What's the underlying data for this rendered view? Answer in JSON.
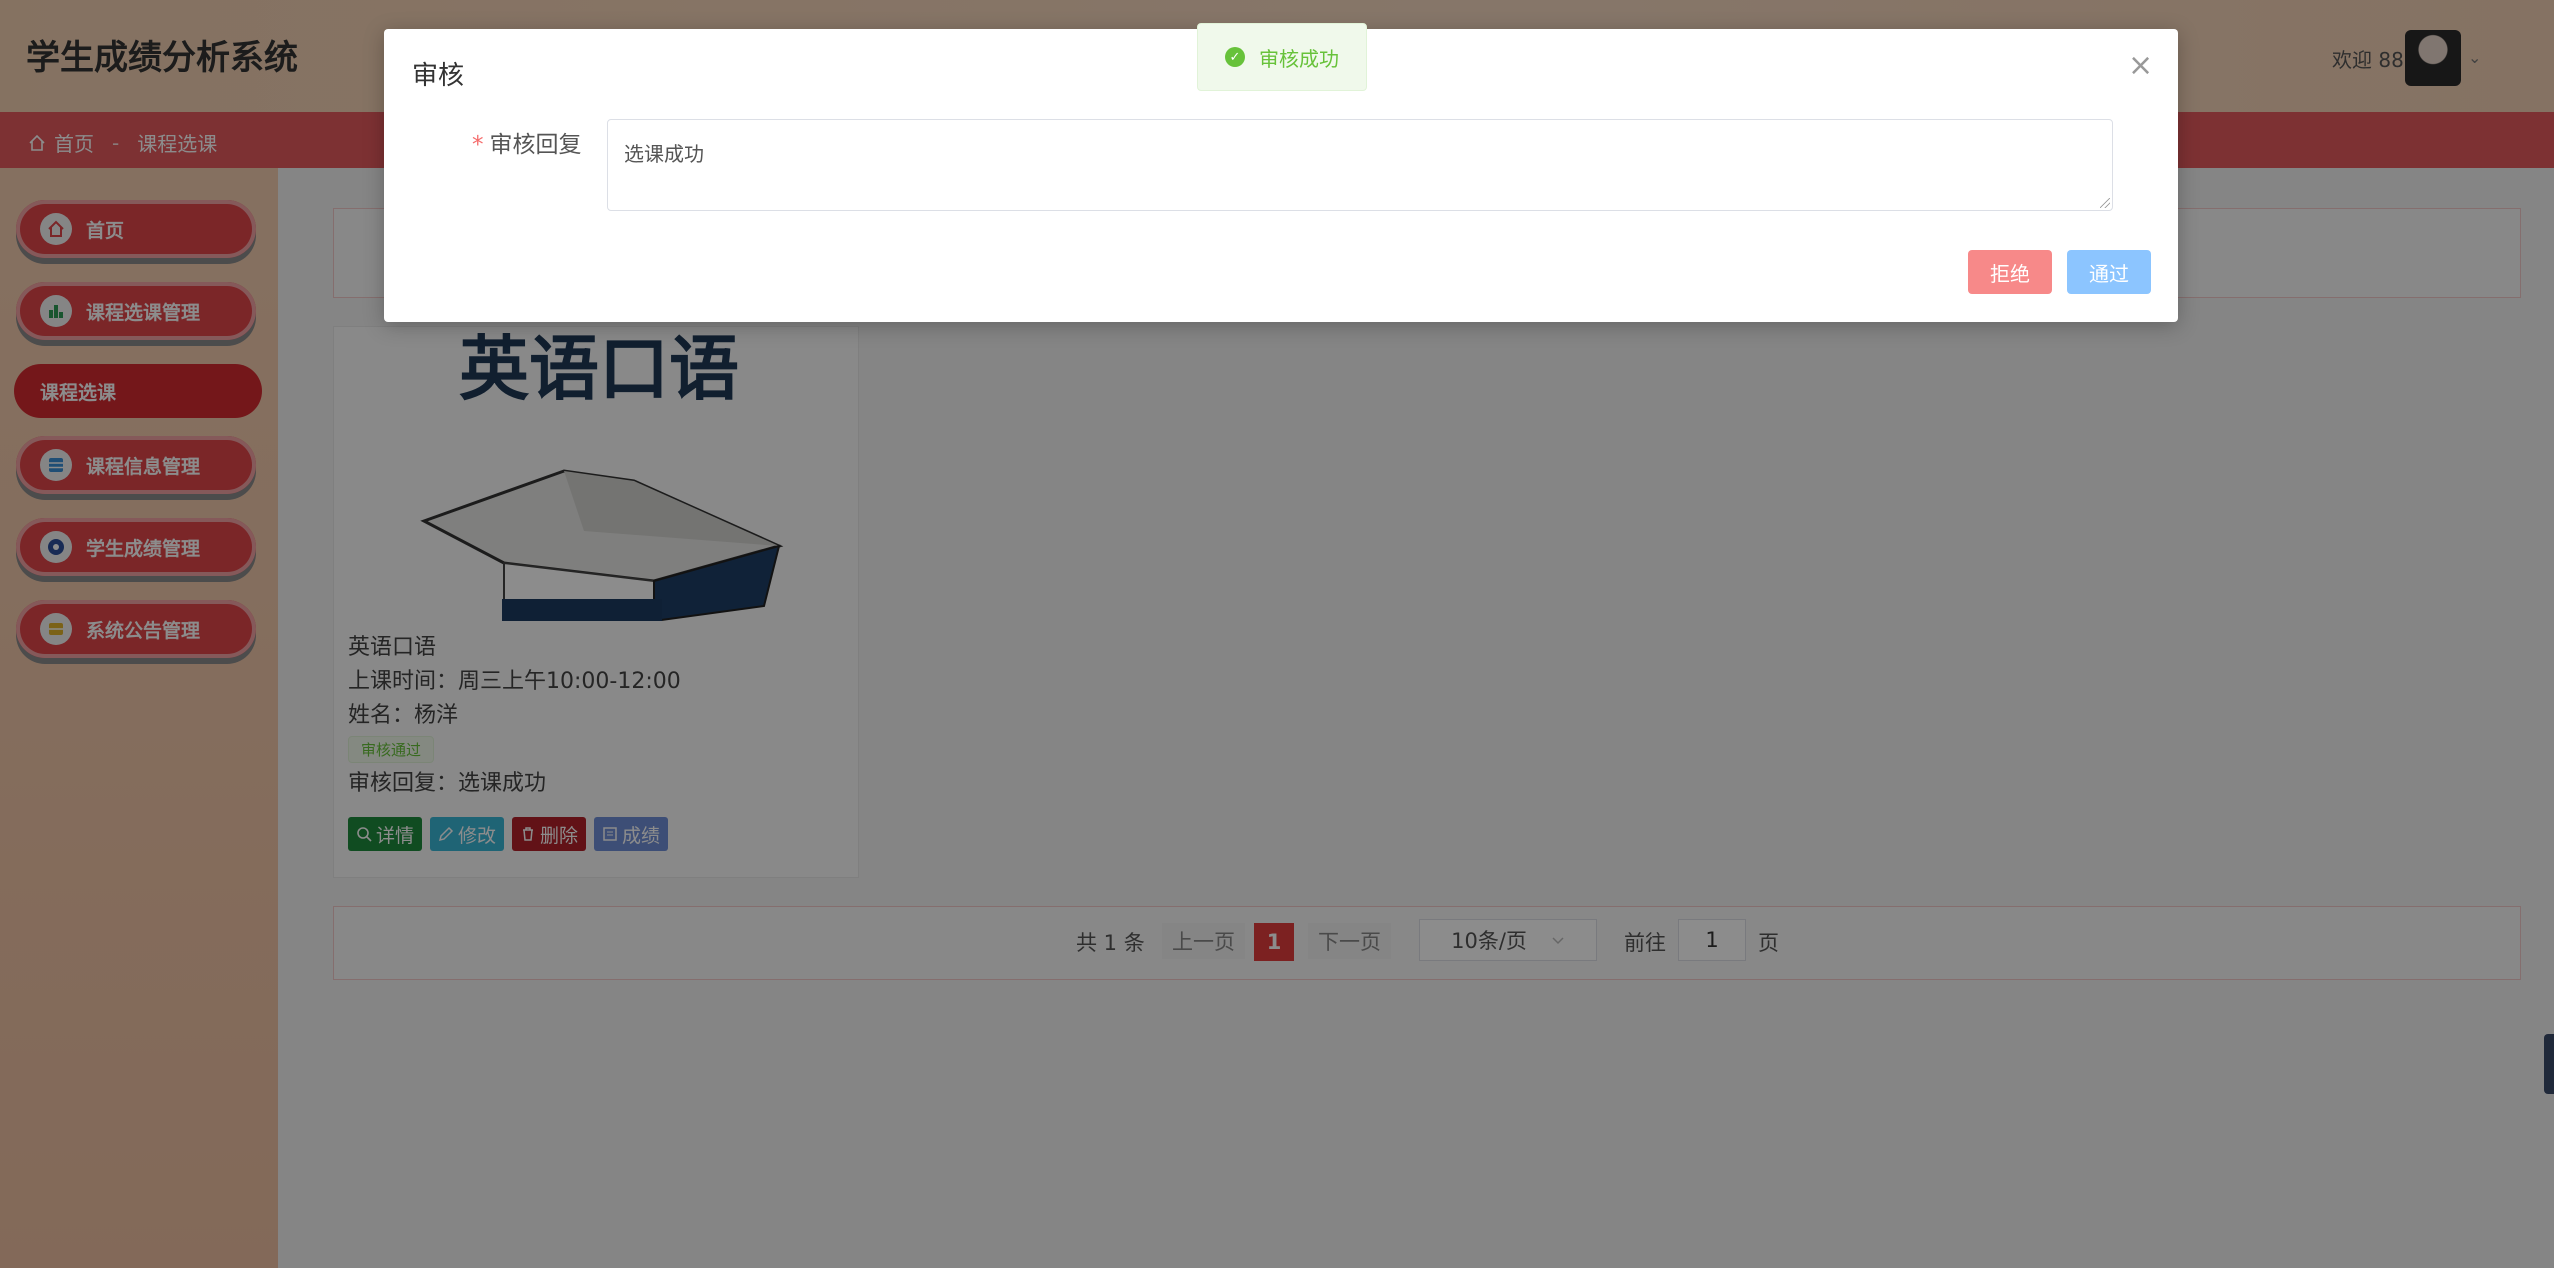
{
  "header": {
    "title": "学生成绩分析系统",
    "welcome": "欢迎 88",
    "caret": "⌄"
  },
  "breadcrumb": {
    "home": "首页",
    "separator": "-",
    "current": "课程选课"
  },
  "sidebar": {
    "items": [
      {
        "label": "首页",
        "icon": "home-icon"
      },
      {
        "label": "课程选课管理",
        "icon": "chart-icon"
      },
      {
        "label": "课程选课",
        "icon": "",
        "active": true
      },
      {
        "label": "课程信息管理",
        "icon": "list-icon"
      },
      {
        "label": "学生成绩管理",
        "icon": "target-icon"
      },
      {
        "label": "系统公告管理",
        "icon": "folder-icon"
      }
    ]
  },
  "card": {
    "course_name": "英语口语",
    "time_label": "上课时间：周三上午10:00-12:00",
    "student_label": "姓名：杨洋",
    "status_badge": "审核通过",
    "reply_label": "审核回复：选课成功",
    "image_banner_text": "英语口语",
    "buttons": {
      "detail": "详情",
      "edit": "修改",
      "delete": "删除",
      "score": "成绩"
    },
    "colors": {
      "detail": "#1e8a3c",
      "edit": "#3ab6d6",
      "delete": "#b3222b",
      "score": "#6f8fd8"
    }
  },
  "pagination": {
    "total": "共 1 条",
    "prev": "上一页",
    "current_page": "1",
    "next": "下一页",
    "page_size": "10条/页",
    "goto_label": "前往",
    "goto_value": "1",
    "page_unit": "页"
  },
  "dialog": {
    "title": "审核",
    "close": "×",
    "field_label": "审核回复",
    "required_mark": "*",
    "reply_value": "选课成功",
    "reject_label": "拒绝",
    "approve_label": "通过",
    "colors": {
      "reject": "#f78989",
      "approve": "#8cc5ff"
    }
  },
  "toast": {
    "message": "审核成功",
    "color": "#67c23a"
  }
}
